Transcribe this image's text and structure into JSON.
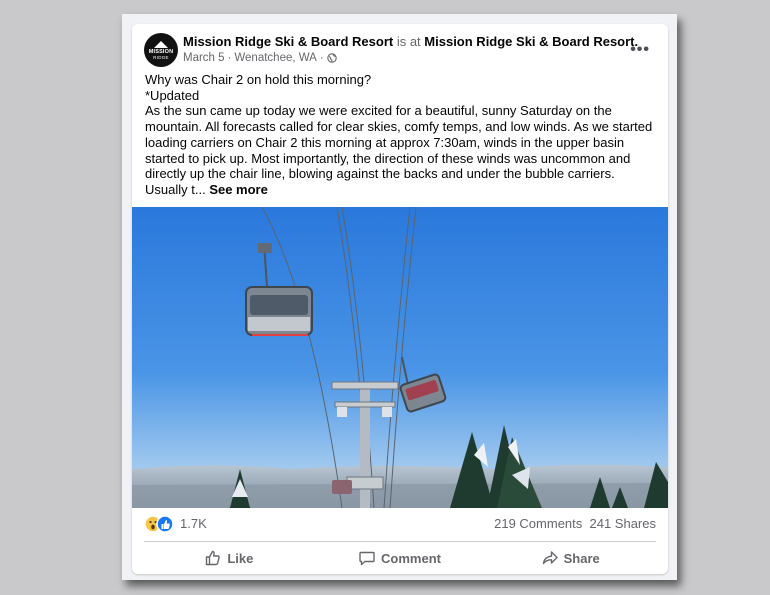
{
  "post": {
    "page_name": "Mission Ridge Ski & Board Resort",
    "is_at": "is at",
    "location_name": "Mission Ridge Ski & Board Resort",
    "date": "March 5",
    "location": "Wenatchee, WA",
    "separator": "·",
    "avatar": {
      "line1": "MISSION",
      "line2": "RIDGE"
    },
    "text": {
      "line1": "Why was  Chair 2 on hold this morning?",
      "line2": "*Updated",
      "body": "As the sun came up today we were excited for a beautiful, sunny Saturday on the mountain. All forecasts called for clear skies, comfy temps, and low winds. As we started loading carriers on Chair 2 this morning at approx 7:30am, winds in the upper basin started to pick up. Most importantly, the direction of these winds was uncommon and directly up the chair line, blowing against the backs and under the bubble carriers. Usually t...",
      "see_more": "See more"
    },
    "more_icon": "more-horizontal-icon",
    "globe_icon": "globe-icon"
  },
  "stats": {
    "reactions_count": "1.7K",
    "comments": "219 Comments",
    "shares": "241 Shares",
    "reaction_icons": [
      "wow-icon",
      "like-icon"
    ]
  },
  "actions": {
    "like": "Like",
    "comment": "Comment",
    "share": "Share"
  },
  "colors": {
    "sky": "#2f7fe0",
    "like_blue": "#1877f2",
    "wow_yellow": "#f7c648",
    "text": "#050505",
    "muted": "#65676b"
  }
}
